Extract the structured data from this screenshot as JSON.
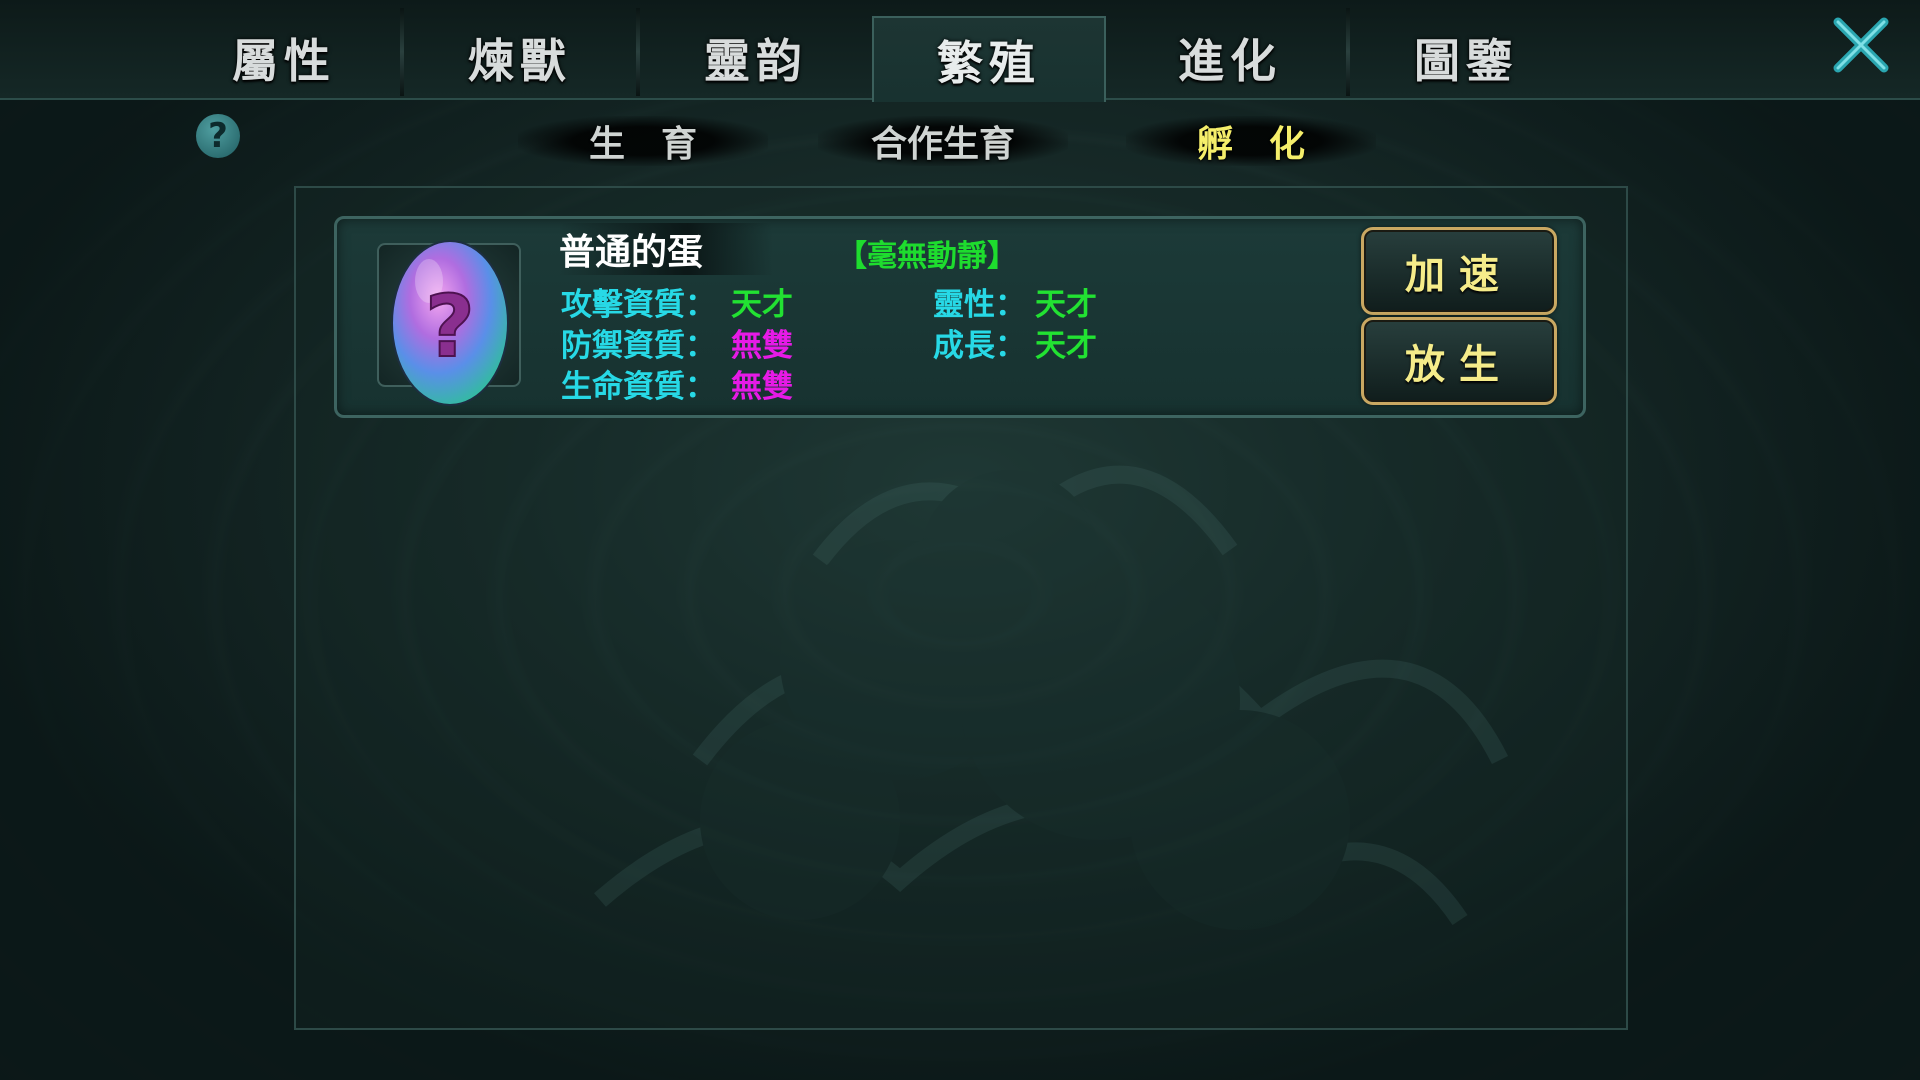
{
  "main_tabs": [
    {
      "label": "屬性"
    },
    {
      "label": "煉獸"
    },
    {
      "label": "靈韵"
    },
    {
      "label": "繁殖"
    },
    {
      "label": "進化"
    },
    {
      "label": "圖鑒"
    }
  ],
  "active_tab": "繁殖",
  "help": {
    "symbol": "?"
  },
  "sub_tabs": [
    {
      "label": "生　育"
    },
    {
      "label": "合作生育"
    },
    {
      "label": "孵　化"
    }
  ],
  "active_sub_tab": "孵　化",
  "egg": {
    "name": "普通的蛋",
    "status": "【毫無動靜】",
    "icon": "mystery-egg-icon",
    "stats_left": [
      {
        "label": "攻擊資質：",
        "value": "天才",
        "color": "green"
      },
      {
        "label": "防禦資質：",
        "value": "無雙",
        "color": "purple"
      },
      {
        "label": "生命資質：",
        "value": "無雙",
        "color": "purple"
      }
    ],
    "stats_right": [
      {
        "label": "靈性：",
        "value": "天才",
        "color": "green"
      },
      {
        "label": "成長：",
        "value": "天才",
        "color": "green"
      }
    ]
  },
  "actions": {
    "speed_up": "加速",
    "release": "放生"
  },
  "colors": {
    "stat_label": "#27d9e6",
    "value_green": "#22e232",
    "value_purple": "#e61ae6",
    "active_subtab": "#f5ee6a",
    "button_border": "#c9a862"
  }
}
